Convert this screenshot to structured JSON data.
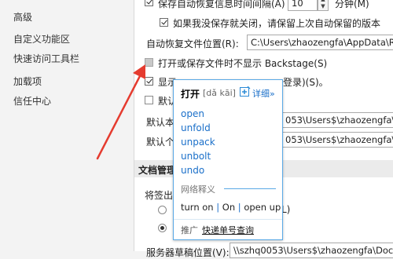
{
  "sidebar": {
    "items": [
      {
        "label": "高级"
      },
      {
        "label": "自定义功能区"
      },
      {
        "label": "快速访问工具栏"
      },
      {
        "label": "加载项"
      },
      {
        "label": "信任中心"
      }
    ]
  },
  "options": {
    "autosave_interval_label": "保存自动恢复信息时间间隔(A)",
    "autosave_interval_value": "10",
    "autosave_unit": "分钟(M)",
    "keep_last_version_label": "如果我没保存就关闭，请保留上次自动保留的版本",
    "autorecover_location_label": "自动恢复文件位置(R):",
    "autorecover_location_value": "C:\\Users\\zhaozengfa\\AppData\\R",
    "no_backstage_label": "打开或保存文件时不显示 Backstage(S)",
    "show_other_locations_label_start": "显示",
    "show_other_locations_label_end": "登录)(S)。",
    "default_save_label": "默认",
    "default_local_label": "默认本",
    "default_local_value": "053\\Users$\\zhaozengfa\\D",
    "default_personal_label": "默认个",
    "default_personal_value": "053\\Users$\\zhaozengfa\\D",
    "section_doc_manage": "文档管理",
    "checkout_label": "将签出",
    "radio_suffix": "L)",
    "server_drafts_label": "服务器草稿位置(V):",
    "server_drafts_value": "\\\\szhq0053\\Users$\\zhaozengfa\\Docu"
  },
  "dictionary_popup": {
    "word": "打开",
    "pronunciation": "[dǎ kāi]",
    "detail_link": "详细»",
    "suggestions": [
      "open",
      "unfold",
      "unpack",
      "unbolt",
      "undo"
    ],
    "web_title": "网络释义",
    "web_values": [
      "turn on",
      "On",
      "open up"
    ],
    "promo_label": "推广",
    "promo_link": "快递单号查询"
  },
  "colors": {
    "accent": "#1a6fc9",
    "popup_border": "#5aa9e6",
    "arrow": "#e53b2f"
  }
}
